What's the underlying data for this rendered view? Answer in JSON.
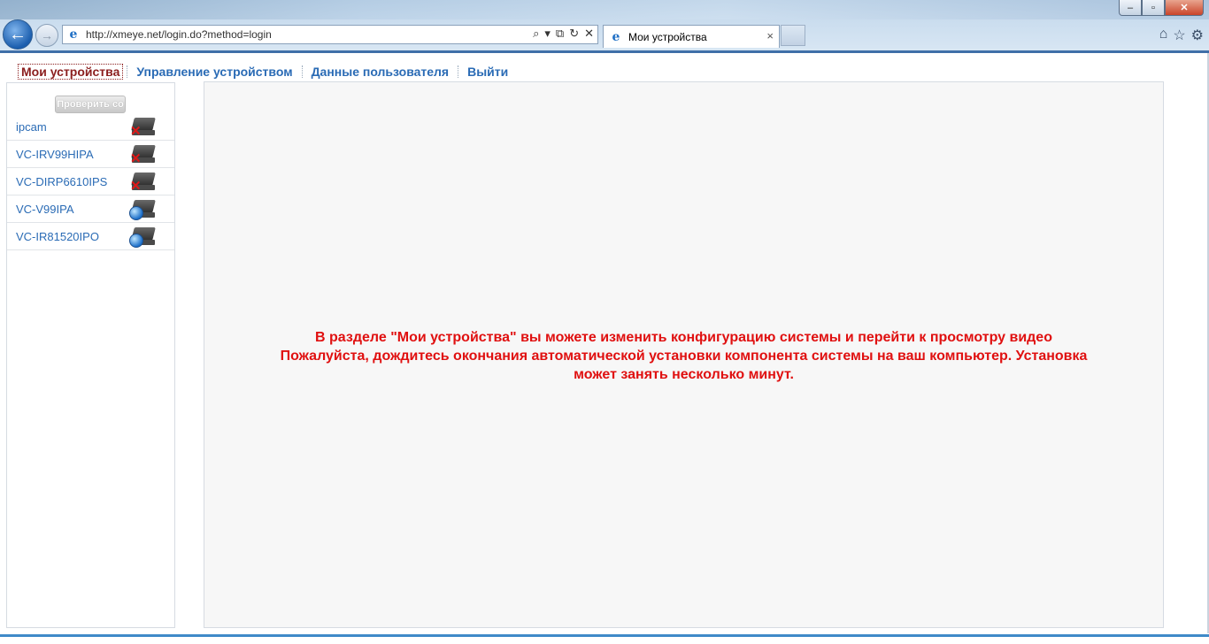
{
  "browser": {
    "url": "http://xmeye.net/login.do?method=login",
    "tab_title": "Мои устройства",
    "tab_close": "×",
    "window_controls": {
      "minimize": "–",
      "maximize": "▫",
      "close": "✕"
    },
    "address_tools": {
      "search": "⌕",
      "dropdown": "▾",
      "compat": "⧉",
      "refresh": "↻",
      "stop": "✕"
    },
    "right_tools": {
      "home": "⌂",
      "favorites": "☆",
      "settings": "⚙"
    },
    "back": "←",
    "forward": "→",
    "ie_logo": "e"
  },
  "topnav": {
    "items": [
      {
        "label": "Мои устройства",
        "active": true
      },
      {
        "label": "Управление устройством",
        "active": false
      },
      {
        "label": "Данные пользователя",
        "active": false
      },
      {
        "label": "Выйти",
        "active": false
      }
    ]
  },
  "sidebar": {
    "check_button": "Проверить со",
    "devices": [
      {
        "name": "ipcam",
        "status": "offline"
      },
      {
        "name": "VC-IRV99HIPA",
        "status": "offline"
      },
      {
        "name": "VC-DIRP6610IPS",
        "status": "offline"
      },
      {
        "name": "VC-V99IPA",
        "status": "online"
      },
      {
        "name": "VC-IR81520IPO",
        "status": "online"
      }
    ],
    "offline_mark": "✕"
  },
  "main": {
    "message_lines": [
      "В разделе \"Мои устройства\" вы можете изменить конфигурацию системы и перейти к просмотру видео",
      "Пожалуйста, дождитесь окончания автоматической установки компонента системы на ваш компьютер. Установка",
      "может занять несколько минут."
    ]
  },
  "colors": {
    "link": "#2a6bb5",
    "active_nav": "#8b1e1e",
    "message": "#e01010"
  }
}
